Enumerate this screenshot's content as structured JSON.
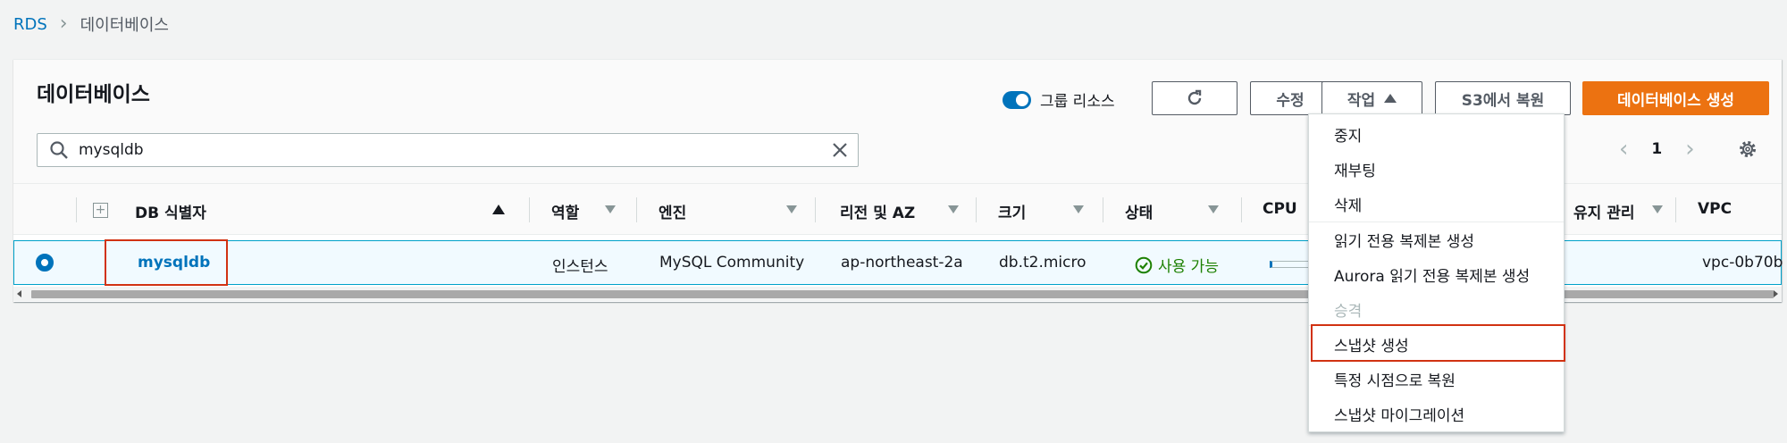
{
  "breadcrumb": {
    "root": "RDS",
    "current": "데이터베이스"
  },
  "panel": {
    "title": "데이터베이스"
  },
  "toolbar": {
    "group_toggle_label": "그룹 리소스",
    "modify_label": "수정",
    "actions_label": "작업",
    "restore_s3_label": "S3에서 복원",
    "create_label": "데이터베이스 생성"
  },
  "search": {
    "value": "mysqldb"
  },
  "pager": {
    "page": "1"
  },
  "columns": {
    "db_id": "DB 식별자",
    "role": "역할",
    "engine": "엔진",
    "region_az": "리전 및 AZ",
    "size": "크기",
    "status": "상태",
    "cpu": "CPU",
    "maintenance": "유지 관리",
    "vpc": "VPC"
  },
  "row": {
    "db_id": "mysqldb",
    "role": "인스턴스",
    "engine": "MySQL Community",
    "region_az": "ap-northeast-2a",
    "size": "db.t2.micro",
    "status": "사용 가능",
    "vpc": "vpc-0b70b"
  },
  "menu": {
    "items": [
      "중지",
      "재부팅",
      "삭제",
      "읽기 전용 복제본 생성",
      "Aurora 읽기 전용 복제본 생성",
      "승격",
      "스냅샷 생성",
      "특정 시점으로 복원",
      "스냅샷 마이그레이션"
    ]
  },
  "colors": {
    "accent": "#0073bb",
    "primary_button": "#ec7211",
    "highlight": "#d13212",
    "success": "#1d8102"
  }
}
